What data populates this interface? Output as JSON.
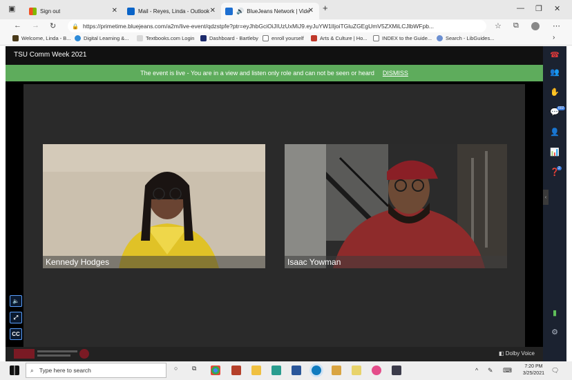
{
  "browser": {
    "tabs": [
      {
        "label": "Sign out",
        "active": false,
        "icon": "microsoft-icon"
      },
      {
        "label": "Mail - Reyes, Linda - Outlook",
        "active": false,
        "icon": "outlook-icon"
      },
      {
        "label": "BlueJeans Network | Video",
        "active": true,
        "icon": "bluejeans-icon"
      }
    ],
    "url": "https://primetime.bluejeans.com/a2m/live-event/qdzstpfe?ptr=eyJhbGciOiJIUzUxMiJ9.eyJuYW1lIjoiTGluZGEgUmV5ZXMiLCJlbWFpb...",
    "bookmarks": [
      {
        "label": "Welcome, Linda - B..."
      },
      {
        "label": "Digital Learning &..."
      },
      {
        "label": "Textbooks.com Login"
      },
      {
        "label": "Dashboard - Bartleby"
      },
      {
        "label": "enroll yourself"
      },
      {
        "label": "Arts & Culture | Ho..."
      },
      {
        "label": "INDEX to the Guide..."
      },
      {
        "label": "Search - LibGuides..."
      }
    ]
  },
  "event": {
    "title": "TSU Comm Week 2021",
    "banner_text": "The event is live - You are in a view and listen only role and can not be seen or heard",
    "dismiss_label": "DISMISS"
  },
  "participants": [
    {
      "name": "Kennedy Hodges"
    },
    {
      "name": "Isaac Yowman"
    }
  ],
  "controls": {
    "cc_label": "CC"
  },
  "rail": {
    "chat_badge": "602",
    "qa_badge": "2"
  },
  "footer": {
    "dolby_label": "Dolby Voice"
  },
  "taskbar": {
    "search_placeholder": "Type here to search",
    "time": "7:20 PM",
    "date": "3/25/2021"
  },
  "colors": {
    "banner": "#5eac5c",
    "rail": "#1b2230",
    "leave_call": "#e0393a"
  }
}
